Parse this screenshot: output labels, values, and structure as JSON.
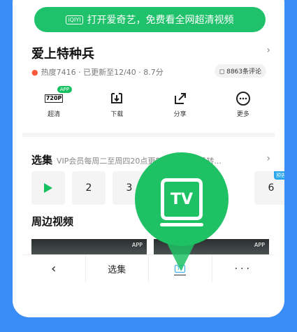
{
  "banner": {
    "logo": "iQIYI",
    "text": "打开爱奇艺，免费看全网超清视频"
  },
  "show": {
    "title": "爱上特种兵",
    "meta": "热度7416 · 已更新至12/40 · 8.7分",
    "comments": "8863条评论"
  },
  "actions": [
    {
      "label": "超清",
      "icon": "720P",
      "badge": "APP"
    },
    {
      "label": "下载",
      "icon": "download-icon"
    },
    {
      "label": "分享",
      "icon": "share-icon"
    },
    {
      "label": "更多",
      "icon": "more-icon"
    }
  ],
  "episodes": {
    "title": "选集",
    "desc": "VIP会员每周二至周四20点更新2集，非会员转...",
    "items": [
      "",
      "2",
      "3",
      "6"
    ],
    "preview_tag": "预告"
  },
  "nearby": {
    "title": "周边视频",
    "thumb_tag": "APP"
  },
  "tabbar": {
    "episodes": "选集",
    "tv": "TV",
    "more": "···"
  },
  "bubble": {
    "text": "TV"
  }
}
